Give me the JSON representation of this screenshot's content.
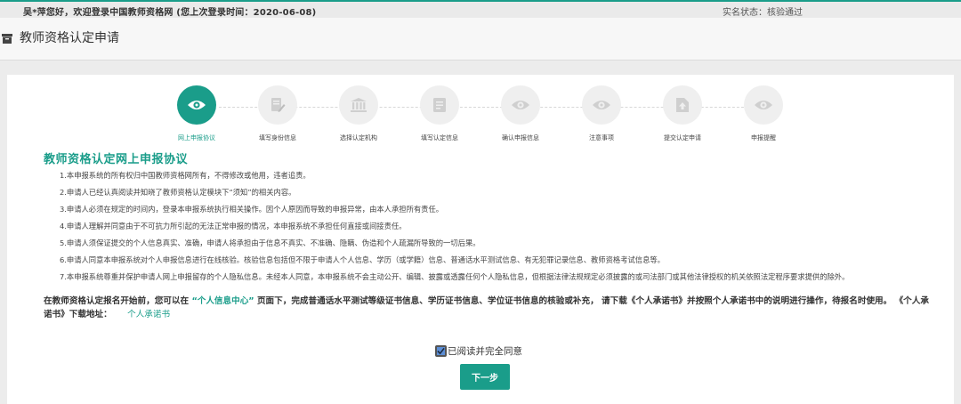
{
  "header": {
    "welcome": "吴*萍您好，欢迎登录中国教师资格网 (您上次登录时间：2020-06-08)",
    "status": "实名状态：核验通过"
  },
  "page": {
    "title": "教师资格认定申请"
  },
  "steps": [
    {
      "label": "网上申报协议",
      "icon": "eye-icon",
      "active": true
    },
    {
      "label": "填写身份信息",
      "icon": "edit-icon",
      "active": false
    },
    {
      "label": "选择认定机构",
      "icon": "institution-icon",
      "active": false
    },
    {
      "label": "填写认定信息",
      "icon": "document-icon",
      "active": false
    },
    {
      "label": "确认申报信息",
      "icon": "eye-icon",
      "active": false
    },
    {
      "label": "注意事项",
      "icon": "eye-icon",
      "active": false
    },
    {
      "label": "提交认定申请",
      "icon": "upload-file-icon",
      "active": false
    },
    {
      "label": "申报提醒",
      "icon": "eye-icon",
      "active": false
    }
  ],
  "agreement": {
    "title": "教师资格认定网上申报协议",
    "items": [
      "1.本申报系统的所有权归中国教师资格网所有，不得修改或他用，违者追责。",
      "2.申请人已经认真阅读并知晓了教师资格认定模块下“须知”的相关内容。",
      "3.申请人必须在规定的时间内，登录本申报系统执行相关操作。因个人原因而导致的申报异常，由本人承担所有责任。",
      "4.申请人理解并同意由于不可抗力所引起的无法正常申报的情况，本申报系统不承担任何直接或间接责任。",
      "5.申请人须保证提交的个人信息真实、准确，申请人将承担由于信息不真实、不准确、隐瞒、伪造和个人疏漏所导致的一切后果。",
      "6.申请人同意本申报系统对个人申报信息进行在线核验。核验信息包括但不限于申请人个人信息、学历（或学籍）信息、普通话水平测试信息、有无犯罪记录信息、教师资格考试信息等。",
      "7.本申报系统尊重并保护申请人网上申报留存的个人隐私信息。未经本人同意，本申报系统不会主动公开、编辑、披露或透露任何个人隐私信息，但根据法律法规规定必须披露的或司法部门或其他法律授权的机关依照法定程序要求提供的除外。"
    ]
  },
  "notice": {
    "part1": "在教师资格认定报名开始前，您可以在",
    "highlight": "“个人信息中心”",
    "part2": "页面下，完成普通话水平测试等级证书信息、学历证书信息、学位证书信息的核验或补充， 请下载《个人承诺书》并按照个人承诺书中的说明进行操作，待报名时使用。 《个人承诺书》下载地址：",
    "link": "个人承诺书"
  },
  "agree_label": "已阅读并完全同意",
  "agree_checked": true,
  "next_button": "下一步",
  "colors": {
    "accent": "#1a9d8a",
    "checkbox": "#5d8fd6"
  }
}
